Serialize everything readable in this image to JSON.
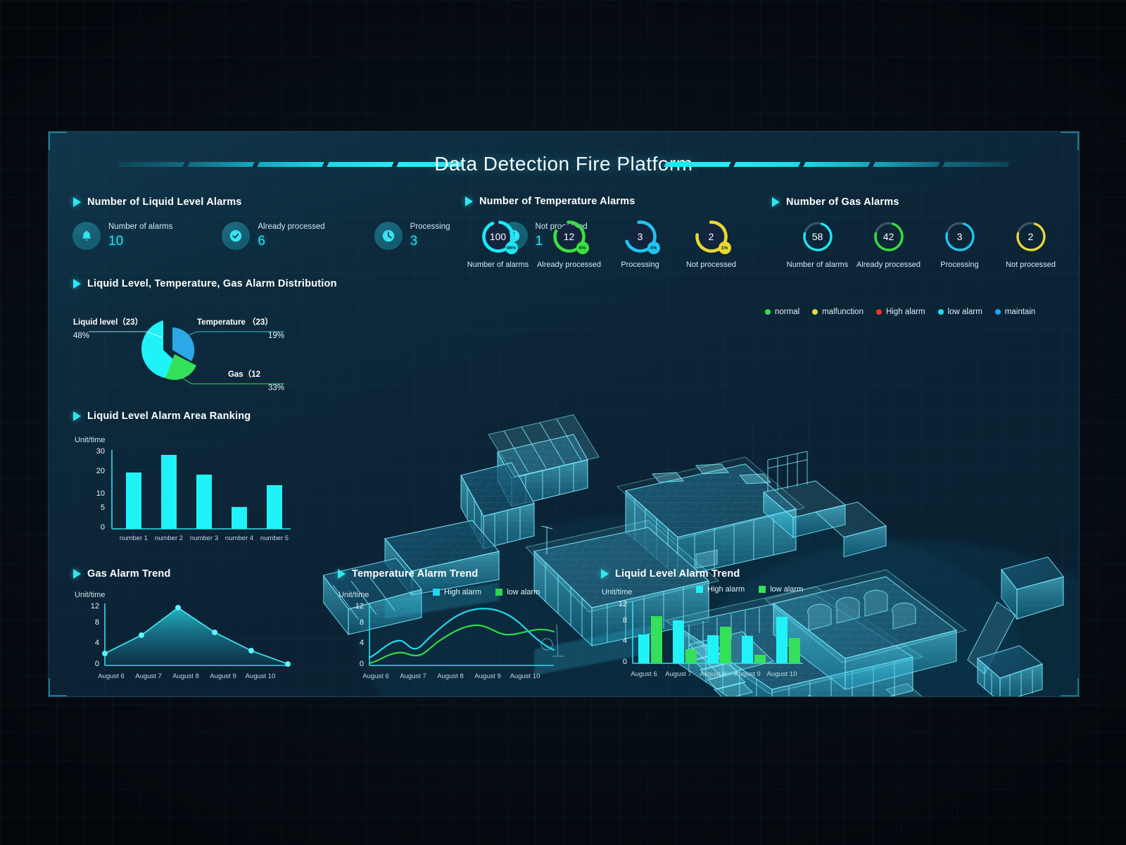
{
  "header": {
    "title": "Data Detection Fire Platform"
  },
  "sections": {
    "liquid_alarms": "Number of Liquid Level Alarms",
    "temperature_alarms": "Number of Temperature Alarms",
    "gas_alarms": "Number of Gas Alarms",
    "distribution": "Liquid Level, Temperature, Gas Alarm Distribution",
    "area_ranking": "Liquid Level Alarm Area Ranking",
    "gas_trend": "Gas Alarm Trend",
    "temperature_trend": "Temperature Alarm Trend",
    "liquid_trend": "Liquid Level Alarm Trend"
  },
  "liquid_stats": [
    {
      "icon": "bell-icon",
      "label": "Number of alarms",
      "value": "10"
    },
    {
      "icon": "check-icon",
      "label": "Already processed",
      "value": "6"
    },
    {
      "icon": "clock-icon",
      "label": "Processing",
      "value": "3"
    },
    {
      "icon": "alert-icon",
      "label": "Not processed",
      "value": "1"
    }
  ],
  "temperature_gauges": [
    {
      "label": "Number of alarms",
      "value": "100",
      "badge": "96%",
      "color": "#1ee7f5",
      "pct": 96
    },
    {
      "label": "Already processed",
      "value": "12",
      "badge": "6%",
      "color": "#3ae03f",
      "pct": 78
    },
    {
      "label": "Processing",
      "value": "3",
      "badge": "4%",
      "color": "#22c3f0",
      "pct": 62
    },
    {
      "label": "Not processed",
      "value": "2",
      "badge": "1%",
      "color": "#e8d832",
      "pct": 70
    }
  ],
  "gas_gauges": [
    {
      "label": "Number of alarms",
      "value": "58",
      "color": "#1ee7f5",
      "pct": 74
    },
    {
      "label": "Already processed",
      "value": "42",
      "color": "#3ae03f",
      "pct": 74
    },
    {
      "label": "Processing",
      "value": "3",
      "color": "#22c3f0",
      "pct": 74
    },
    {
      "label": "Not processed",
      "value": "2",
      "color": "#e8d832",
      "pct": 74
    }
  ],
  "model_legend": [
    {
      "label": "normal",
      "color": "#35e04a"
    },
    {
      "label": "malfunction",
      "color": "#ead835"
    },
    {
      "label": "High alarm",
      "color": "#f23030"
    },
    {
      "label": "low alarm",
      "color": "#24d7ee"
    },
    {
      "label": "maintain",
      "color": "#1aa6f0"
    }
  ],
  "chart_data": [
    {
      "id": "distribution_pie",
      "type": "pie",
      "title": "Liquid Level, Temperature, Gas Alarm Distribution",
      "legend_position": "callout",
      "slices": [
        {
          "label": "Liquid level（23）",
          "name": "Liquid level",
          "count": 23,
          "percent": "48%",
          "value": 48,
          "color": "#1ff3f8"
        },
        {
          "label": "Temperature （23）",
          "name": "Temperature",
          "count": 23,
          "percent": "19%",
          "value": 19,
          "color": "#2aa8e8"
        },
        {
          "label": "Gas（12",
          "name": "Gas",
          "count": 12,
          "percent": "33%",
          "value": 33,
          "color": "#35e05a"
        }
      ]
    },
    {
      "id": "area_ranking_bar",
      "type": "bar",
      "title": "Liquid Level Alarm Area Ranking",
      "ylabel": "Unit/time",
      "xlabel": "",
      "categories": [
        "number 1",
        "number 2",
        "number 3",
        "number 4",
        "number 5"
      ],
      "values": [
        20,
        29,
        19,
        6,
        14
      ],
      "yticks": [
        "0",
        "5",
        "10",
        "20",
        "30"
      ],
      "ylim": [
        0,
        30
      ],
      "grid": false,
      "color": "#1ff3f8"
    },
    {
      "id": "gas_alarm_trend_area",
      "type": "area",
      "title": "Gas Alarm Trend",
      "ylabel": "Unit/time",
      "x": [
        "August 6",
        "August 7",
        "August 8",
        "August 9",
        "August 10"
      ],
      "values": [
        2.3,
        5.7,
        12.3,
        6.7,
        2.8,
        0.2
      ],
      "yticks": [
        "0",
        "4",
        "8",
        "12"
      ],
      "ylim": [
        0,
        13
      ],
      "grid": false,
      "color": "#2ae4f2"
    },
    {
      "id": "temperature_alarm_trend_line",
      "type": "line",
      "title": "Temperature Alarm Trend",
      "ylabel": "Unit/time",
      "x": [
        "August 6",
        "August 7",
        "August 8",
        "August 9",
        "August 10"
      ],
      "yticks": [
        "0",
        "4",
        "8",
        "12"
      ],
      "ylim": [
        0,
        13
      ],
      "grid": false,
      "series": [
        {
          "name": "High alarm",
          "color": "#22d8ee",
          "values": [
            1.5,
            5.0,
            4.0,
            11.2,
            12.0,
            6.2
          ]
        },
        {
          "name": "low alarm",
          "color": "#2fd94a",
          "values": [
            0.5,
            3.0,
            2.1,
            8.7,
            6.9,
            7.5
          ]
        }
      ]
    },
    {
      "id": "liquid_level_alarm_trend_bar",
      "type": "bar",
      "title": "Liquid Level Alarm Trend",
      "ylabel": "Unit/time",
      "categories": [
        "August 6",
        "August 7",
        "August 8",
        "August 9",
        "August 10"
      ],
      "yticks": [
        "0",
        "4",
        "8",
        "12"
      ],
      "ylim": [
        0,
        12
      ],
      "grid": false,
      "series": [
        {
          "name": "High alarm",
          "color": "#1ff3f8",
          "values": [
            5.7,
            8.4,
            5.6,
            5.4,
            9.2
          ]
        },
        {
          "name": "low alarm",
          "color": "#35e05a",
          "values": [
            9.3,
            2.8,
            7.2,
            1.6,
            5.0
          ]
        }
      ]
    }
  ],
  "legend_labels": {
    "high_alarm": "High alarm",
    "low_alarm": "low alarm"
  },
  "colors": {
    "accent": "#1ff3f8",
    "green": "#35e05a",
    "yellow": "#ead835",
    "red": "#f23030",
    "blue": "#1aa6f0",
    "panel_bg": "#0b2335"
  }
}
